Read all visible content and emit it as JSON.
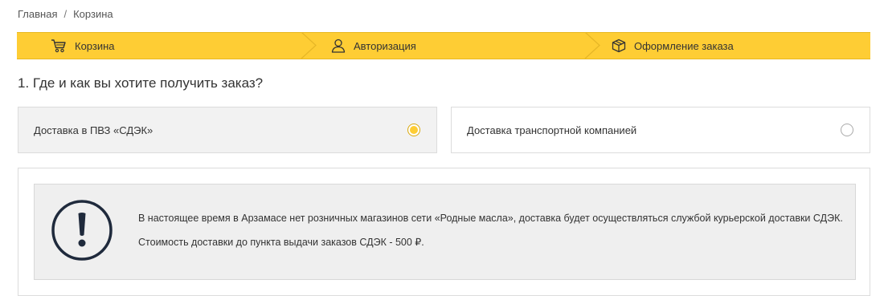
{
  "breadcrumb": {
    "home": "Главная",
    "separator": "/",
    "current": "Корзина"
  },
  "steps": [
    {
      "label": "Корзина",
      "icon": "cart-icon"
    },
    {
      "label": "Авторизация",
      "icon": "user-icon"
    },
    {
      "label": "Оформление заказа",
      "icon": "box-icon"
    }
  ],
  "question": "1. Где и как вы хотите получить заказ?",
  "delivery_options": [
    {
      "label": "Доставка в ПВЗ «СДЭК»",
      "selected": true
    },
    {
      "label": "Доставка транспортной компанией",
      "selected": false
    }
  ],
  "notice": {
    "icon": "exclamation-icon",
    "line1": "В настоящее время в Арзамасе нет розничных магазинов сети «Родные масла», доставка будет осуществляться службой курьерской доставки СДЭК.",
    "line2": "Стоимость доставки до пункта выдачи заказов СДЭК - 500 ₽."
  },
  "colors": {
    "accent": "#fecd34",
    "panel_bg": "#efefef",
    "selected_option_bg": "#f2f2f2"
  }
}
